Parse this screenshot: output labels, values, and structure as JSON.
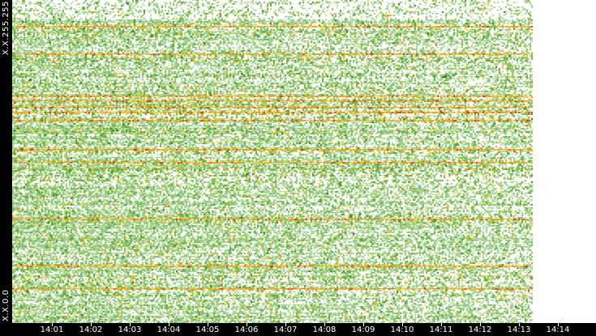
{
  "chart_data": {
    "type": "heatmap",
    "title": "",
    "y_labels": {
      "top": "X.X.255.255",
      "bottom": "X.X.0.0"
    },
    "x_ticks": [
      "14:01",
      "14:02",
      "14:03",
      "14:04",
      "14:05",
      "14:06",
      "14:07",
      "14:08",
      "14:09",
      "14:10",
      "14:11",
      "14:12",
      "14:13",
      "14:14"
    ],
    "x_range": [
      "14:00:40",
      "14:13:00"
    ],
    "palette": {
      "empty": "#ffffff",
      "low": "#9fd08a",
      "mid": "#74b84a",
      "midhigh": "#4f9e2a",
      "dark": "#2f6e1a",
      "high": "#f0d000",
      "higher": "#ff9a00",
      "highest": "#e83000"
    },
    "hot_rows_fraction": [
      0.08,
      0.165,
      0.295,
      0.31,
      0.33,
      0.345,
      0.37,
      0.46,
      0.5,
      0.675,
      0.82,
      0.89
    ]
  }
}
